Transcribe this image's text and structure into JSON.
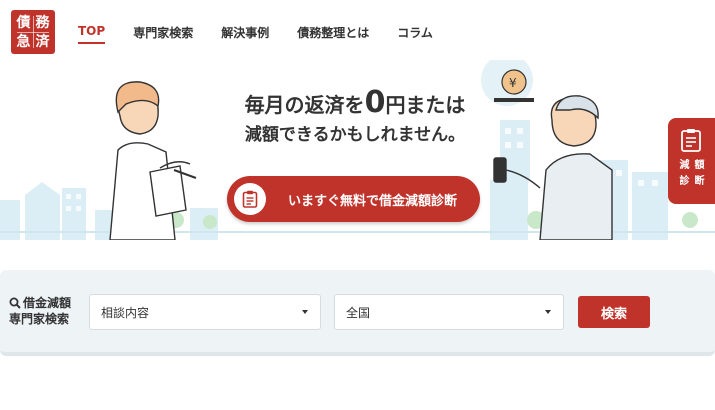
{
  "logo": {
    "chars": [
      "債",
      "務",
      "急",
      "済"
    ]
  },
  "nav": [
    {
      "label": "TOP",
      "active": true
    },
    {
      "label": "専門家検索"
    },
    {
      "label": "解決事例"
    },
    {
      "label": "債務整理とは"
    },
    {
      "label": "コラム"
    }
  ],
  "hero": {
    "headline_pre": "毎月の返済を",
    "headline_zero": "0",
    "headline_post": "円または",
    "headline_line2": "減額できるかもしれません。",
    "cta_label": "いますぐ無料で借金減額診断",
    "cta_icon": "clipboard-icon"
  },
  "side_tab": {
    "chars": [
      "減",
      "額",
      "診",
      "断"
    ],
    "icon": "clipboard-icon"
  },
  "search": {
    "label_line1": "借金減額",
    "label_line2": "専門家検索",
    "consult_value": "相談内容",
    "region_value": "全国",
    "button_label": "検索"
  },
  "colors": {
    "brand_red": "#c0332b",
    "panel_bg": "#eef3f6"
  }
}
